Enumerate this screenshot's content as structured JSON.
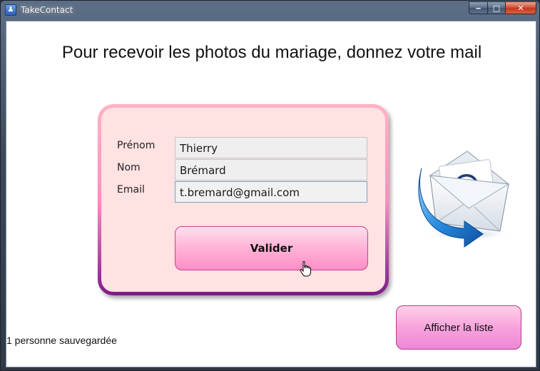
{
  "window": {
    "title": "TakeContact",
    "app_icon_glyph": "♟",
    "buttons": {
      "minimize": "‒",
      "maximize": "□",
      "close": "✕"
    }
  },
  "main": {
    "headline": "Pour recevoir les photos du mariage, donnez votre mail",
    "form": {
      "firstname_label": "Prénom",
      "firstname_value": "Thierry",
      "lastname_label": "Nom",
      "lastname_value": "Brémard",
      "email_label": "Email",
      "email_value": "t.bremard@gmail.com",
      "submit_label": "Valider"
    },
    "status_text": "1 personne sauvegardée",
    "show_list_label": "Afficher la liste"
  },
  "colors": {
    "panel_bg": "#ffe2e2",
    "panel_border_top": "#ffb3c4",
    "panel_border_bottom": "#7d1a85",
    "button_pink": "#ff8ec6"
  },
  "icons": [
    "app-icon",
    "minimize-icon",
    "maximize-icon",
    "close-icon",
    "email-envelope-icon",
    "hand-cursor-icon"
  ]
}
